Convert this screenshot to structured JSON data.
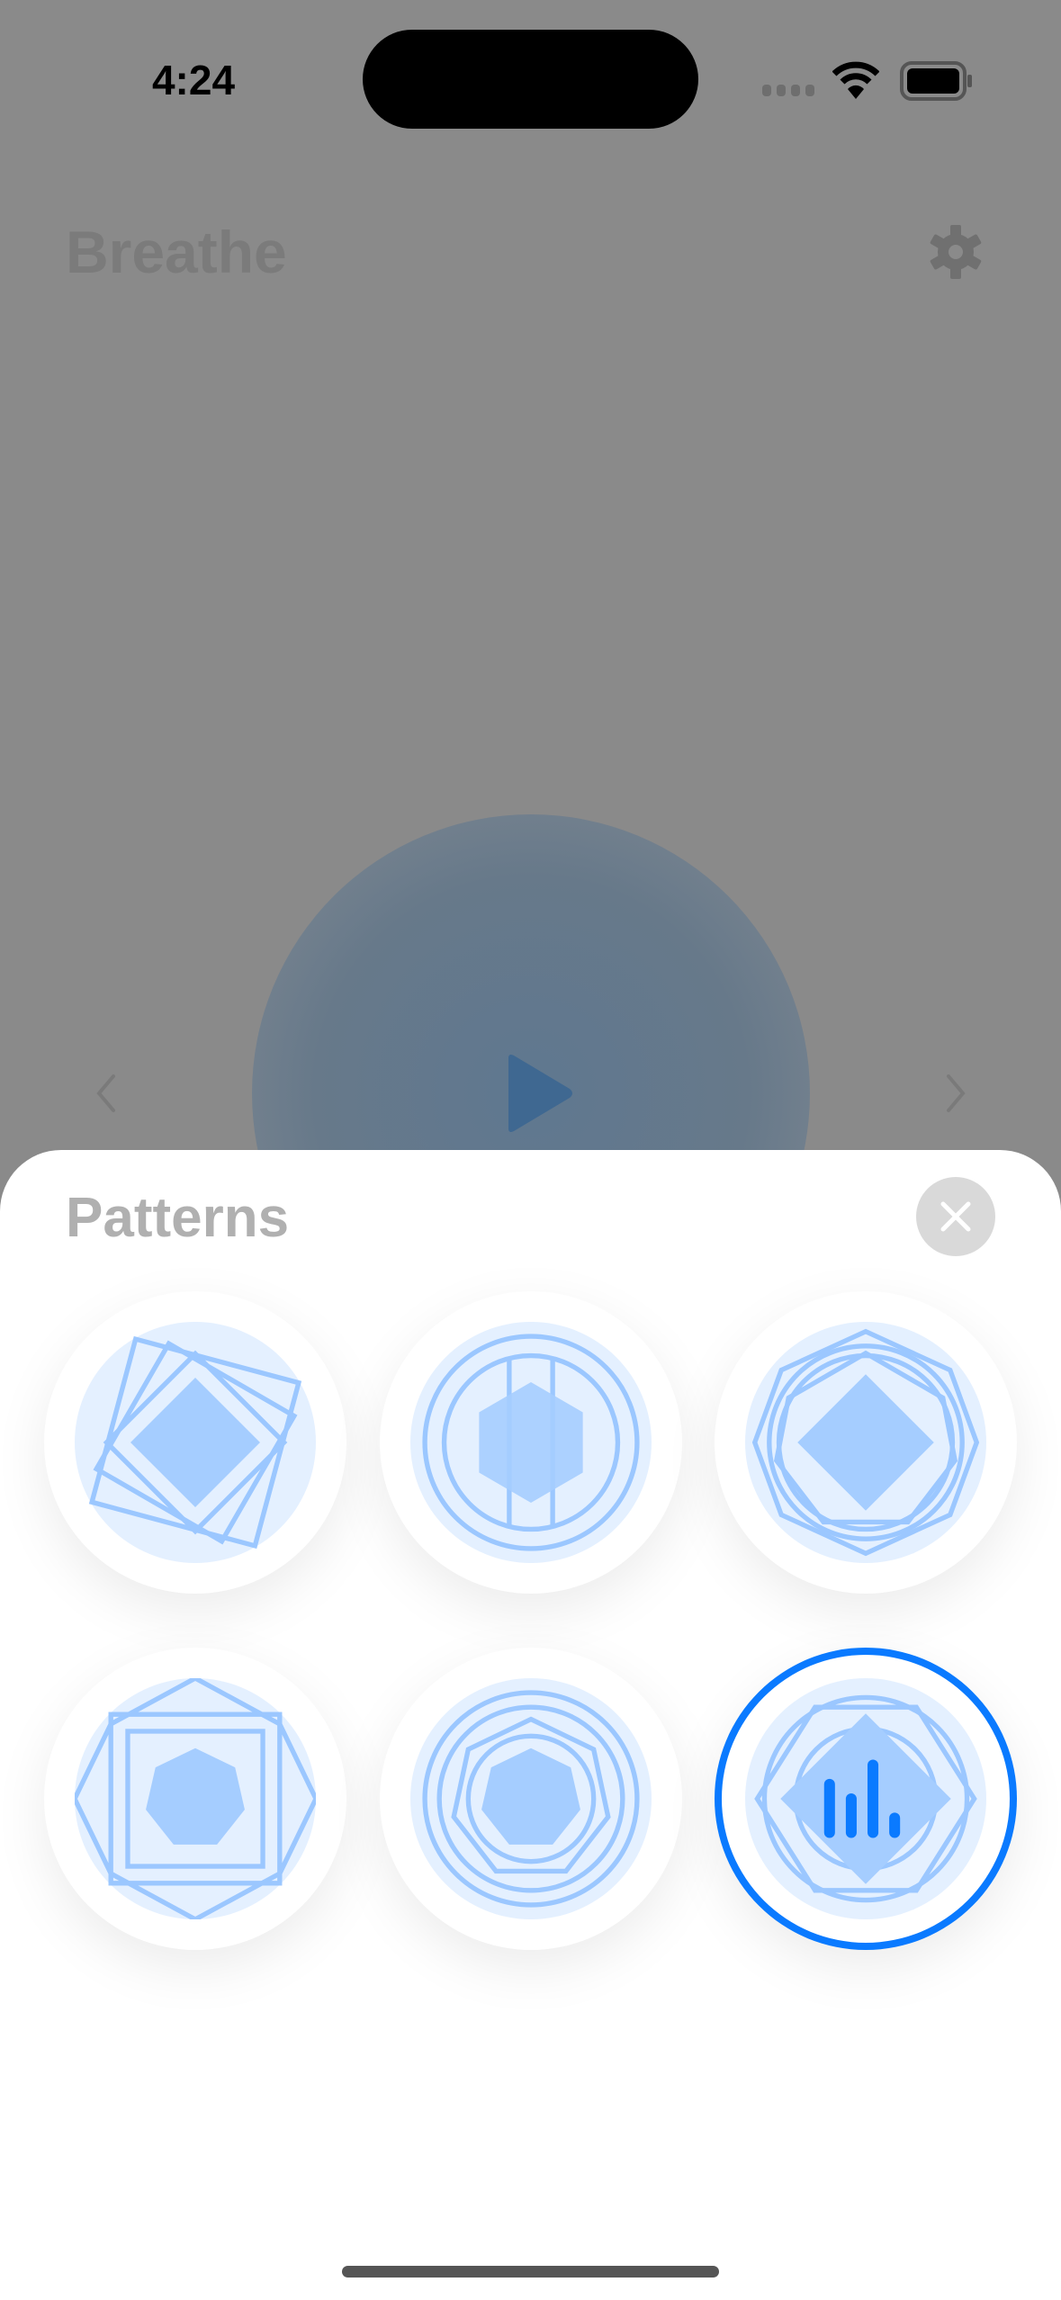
{
  "status_bar": {
    "time": "4:24",
    "icons": [
      "signal-icon",
      "wifi-icon",
      "battery-icon"
    ]
  },
  "app": {
    "title": "Breathe",
    "settings_icon": "gear-icon",
    "play_icon": "play-icon",
    "prev_icon": "chevron-left-icon",
    "next_icon": "chevron-right-icon"
  },
  "sheet": {
    "title": "Patterns",
    "close_icon": "close-icon",
    "patterns": [
      {
        "icon": "rotating-squares-icon",
        "selected": false
      },
      {
        "icon": "hexagon-circles-icon",
        "selected": false
      },
      {
        "icon": "octagon-diamond-icon",
        "selected": false
      },
      {
        "icon": "heptagon-square-icon",
        "selected": false
      },
      {
        "icon": "heptagon-circles-icon",
        "selected": false
      },
      {
        "icon": "soundwave-diamond-icon",
        "selected": true
      }
    ]
  },
  "colors": {
    "accent": "#0a7aff",
    "shape": "#a5cdff",
    "shape_bg": "#e4f0ff"
  }
}
